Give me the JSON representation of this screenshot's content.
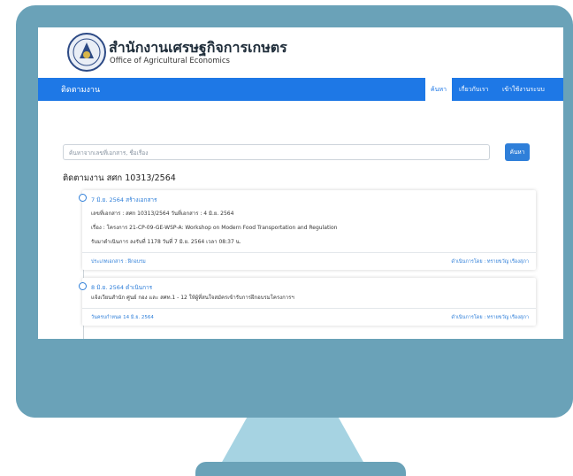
{
  "header": {
    "title_th": "สำนักงานเศรษฐกิจการเกษตร",
    "title_en": "Office of Agricultural Economics"
  },
  "navbar": {
    "brand": "ติดตามงาน",
    "items": [
      {
        "label": "ค้นหา",
        "active": true
      },
      {
        "label": "เกี่ยวกับเรา",
        "active": false
      },
      {
        "label": "เข้าใช้งานระบบ",
        "active": false
      }
    ]
  },
  "search": {
    "placeholder": "ค้นหาจากเลขที่เอกสาร, ชื่อเรื่อง",
    "button_label": "ค้นหา"
  },
  "tracking": {
    "title": "ติดตามงาน สศก 10313/2564",
    "entries": [
      {
        "heading": "7 มิ.ย. 2564 สร้างเอกสาร",
        "lines": [
          "เลขที่เอกสาร : สศก 10313/2564 วันที่เอกสาร : 4 มิ.ย. 2564",
          "เรื่อง : โครงการ 21-CP-09-GE-WSP-A: Workshop on Modern Food Transportation and Regulation",
          "รับมาดำเนินการ ลงรับที่ 1178 วันที่ 7 มิ.ย. 2564 เวลา 08:37 น."
        ],
        "footer_left": "ประเภทเอกสาร : ฝึกอบรม",
        "footer_right": "ดำเนินการโดย : ทรายขวัญ เรืองสุภา"
      },
      {
        "heading": "8 มิ.ย. 2564 ดำเนินการ",
        "lines": [
          "แจ้งเวียนสำนัก ศูนย์ กอง และ สศท.1 - 12 ให้ผู้ที่สนใจสมัครเข้ารับการฝึกอบรมโครงการฯ"
        ],
        "footer_left": "วันครบกำหนด 14 มิ.ย. 2564",
        "footer_right": "ดำเนินการโดย : ทรายขวัญ เรืองสุภา"
      }
    ]
  },
  "colors": {
    "monitor": "#6aa2b8",
    "stand": "#a6d3e2",
    "navbar": "#1e78e6",
    "accent": "#2f7fd9"
  },
  "icons": {
    "logo": "oae-seal-logo"
  }
}
